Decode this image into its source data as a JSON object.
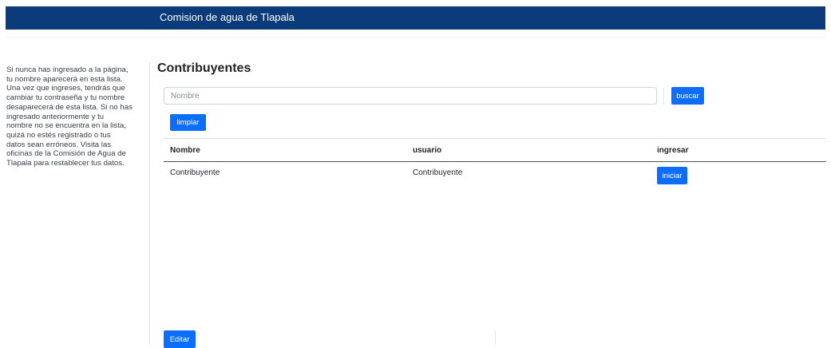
{
  "header": {
    "title": "Comision de agua de Tlapala"
  },
  "sidebar": {
    "lines": [
      "Si nunca has ingresado a la página,",
      "tu nombre aparecerá en esta lista.",
      "Una vez que ingreses, tendrás que",
      "cambiar tu contraseña y tu nombre",
      "desaparecerá de esta lista. Si no has",
      "ingresado anteriormente y tu",
      "nombre no se encuentra en la lista,",
      "quizá no estés registrado o tus",
      "datos sean erróneos. Visita las",
      "oficinas de la Comisión de Agua de",
      "Tlapala para restablecer tus datos."
    ]
  },
  "main": {
    "title": "Contribuyentes",
    "search": {
      "placeholder": "Nombre",
      "value": ""
    },
    "buttons": {
      "search": "buscar",
      "clear": "limpiar",
      "edit": "Editar"
    },
    "table": {
      "columns": [
        "Nombre",
        "usuario",
        "ingresar"
      ],
      "rows": [
        {
          "nombre": "Contribuyente",
          "usuario": "Contribuyente",
          "action": "iniciar"
        }
      ]
    }
  },
  "colors": {
    "header": "#0b3b7a",
    "primary": "#0d6efd"
  }
}
